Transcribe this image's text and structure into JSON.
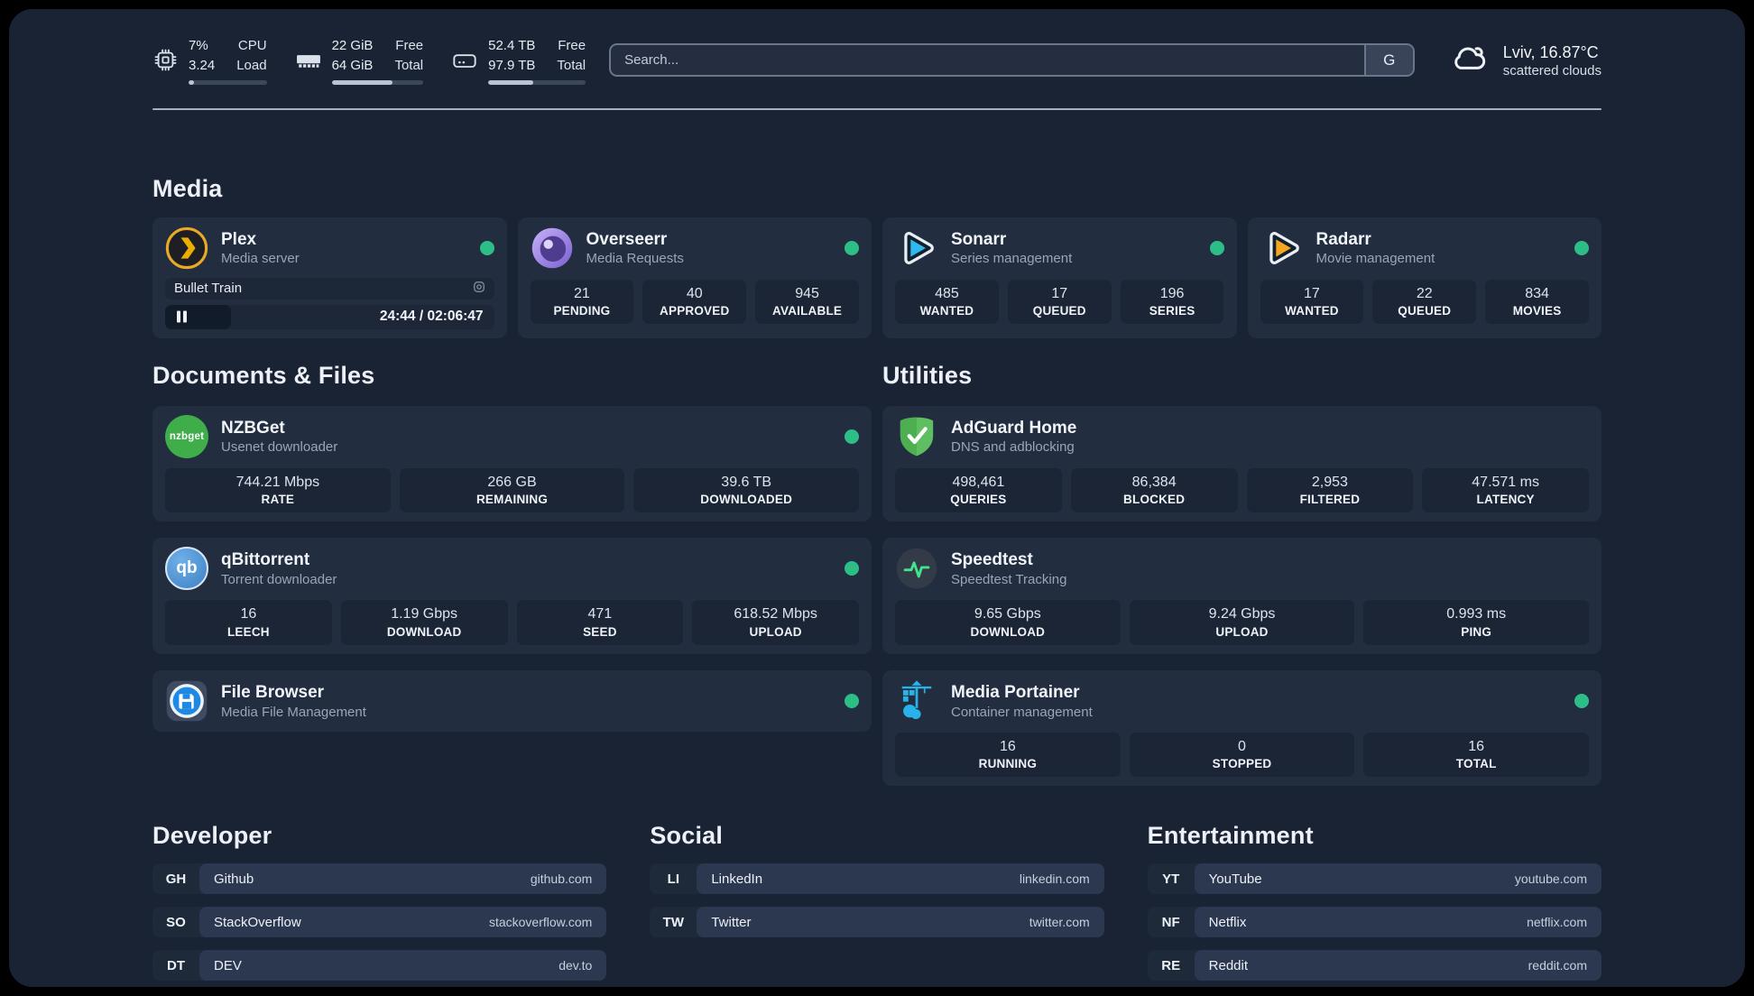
{
  "colors": {
    "status_online": "#2dbe87",
    "background": "#1a2333",
    "card": "#222d3f",
    "stat_box": "#1b2535",
    "accent_plex": "#ebaf00",
    "accent_sonarr": "#2fb9ee",
    "accent_radarr": "#f5a623",
    "accent_nzbget": "#3fae4a",
    "accent_adguard": "#5fbe62",
    "accent_qbittorrent": "#4d8fd1",
    "accent_speedtest": "#41e38b",
    "accent_filebrowser": "#1e88e5",
    "accent_portainer": "#29b2e8"
  },
  "header": {
    "stats": [
      {
        "icon": "cpu-icon",
        "value_top": "7%",
        "value_bottom": "3.24",
        "label_top": "CPU",
        "label_bottom": "Load",
        "progress": 7
      },
      {
        "icon": "memory-icon",
        "value_top": "22 GiB",
        "value_bottom": "64 GiB",
        "label_top": "Free",
        "label_bottom": "Total",
        "progress": 66
      },
      {
        "icon": "disk-icon",
        "value_top": "52.4 TB",
        "value_bottom": "97.9 TB",
        "label_top": "Free",
        "label_bottom": "Total",
        "progress": 46
      }
    ],
    "search": {
      "placeholder": "Search...",
      "engine_button": "G"
    },
    "weather": {
      "location_temp": "Lviv, 16.87°C",
      "condition": "scattered clouds"
    }
  },
  "sections": {
    "media": "Media",
    "documents": "Documents & Files",
    "utilities": "Utilities",
    "developer": "Developer",
    "social": "Social",
    "entertainment": "Entertainment"
  },
  "apps": {
    "plex": {
      "name": "Plex",
      "desc": "Media server",
      "now_playing": {
        "title": "Bullet Train",
        "time": "24:44 / 02:06:47",
        "progress": 20
      }
    },
    "overseerr": {
      "name": "Overseerr",
      "desc": "Media Requests",
      "stats": [
        {
          "value": "21",
          "label": "PENDING"
        },
        {
          "value": "40",
          "label": "APPROVED"
        },
        {
          "value": "945",
          "label": "AVAILABLE"
        }
      ]
    },
    "sonarr": {
      "name": "Sonarr",
      "desc": "Series management",
      "stats": [
        {
          "value": "485",
          "label": "WANTED"
        },
        {
          "value": "17",
          "label": "QUEUED"
        },
        {
          "value": "196",
          "label": "SERIES"
        }
      ]
    },
    "radarr": {
      "name": "Radarr",
      "desc": "Movie management",
      "stats": [
        {
          "value": "17",
          "label": "WANTED"
        },
        {
          "value": "22",
          "label": "QUEUED"
        },
        {
          "value": "834",
          "label": "MOVIES"
        }
      ]
    },
    "nzbget": {
      "name": "NZBGet",
      "desc": "Usenet downloader",
      "logo_text": "nzbget",
      "stats": [
        {
          "value": "744.21 Mbps",
          "label": "RATE"
        },
        {
          "value": "266 GB",
          "label": "REMAINING"
        },
        {
          "value": "39.6 TB",
          "label": "DOWNLOADED"
        }
      ]
    },
    "qbittorrent": {
      "name": "qBittorrent",
      "desc": "Torrent downloader",
      "logo_text": "qb",
      "stats": [
        {
          "value": "16",
          "label": "LEECH"
        },
        {
          "value": "1.19 Gbps",
          "label": "DOWNLOAD"
        },
        {
          "value": "471",
          "label": "SEED"
        },
        {
          "value": "618.52 Mbps",
          "label": "UPLOAD"
        }
      ]
    },
    "filebrowser": {
      "name": "File Browser",
      "desc": "Media File Management"
    },
    "adguard": {
      "name": "AdGuard Home",
      "desc": "DNS and adblocking",
      "stats": [
        {
          "value": "498,461",
          "label": "QUERIES"
        },
        {
          "value": "86,384",
          "label": "BLOCKED"
        },
        {
          "value": "2,953",
          "label": "FILTERED"
        },
        {
          "value": "47.571 ms",
          "label": "LATENCY"
        }
      ]
    },
    "speedtest": {
      "name": "Speedtest",
      "desc": "Speedtest Tracking",
      "stats": [
        {
          "value": "9.65 Gbps",
          "label": "DOWNLOAD"
        },
        {
          "value": "9.24 Gbps",
          "label": "UPLOAD"
        },
        {
          "value": "0.993 ms",
          "label": "PING"
        }
      ]
    },
    "portainer": {
      "name": "Media Portainer",
      "desc": "Container management",
      "stats": [
        {
          "value": "16",
          "label": "RUNNING"
        },
        {
          "value": "0",
          "label": "STOPPED"
        },
        {
          "value": "16",
          "label": "TOTAL"
        }
      ]
    }
  },
  "bookmarks": {
    "developer": [
      {
        "tag": "GH",
        "name": "Github",
        "url": "github.com"
      },
      {
        "tag": "SO",
        "name": "StackOverflow",
        "url": "stackoverflow.com"
      },
      {
        "tag": "DT",
        "name": "DEV",
        "url": "dev.to"
      }
    ],
    "social": [
      {
        "tag": "LI",
        "name": "LinkedIn",
        "url": "linkedin.com"
      },
      {
        "tag": "TW",
        "name": "Twitter",
        "url": "twitter.com"
      }
    ],
    "entertainment": [
      {
        "tag": "YT",
        "name": "YouTube",
        "url": "youtube.com"
      },
      {
        "tag": "NF",
        "name": "Netflix",
        "url": "netflix.com"
      },
      {
        "tag": "RE",
        "name": "Reddit",
        "url": "reddit.com"
      }
    ]
  }
}
